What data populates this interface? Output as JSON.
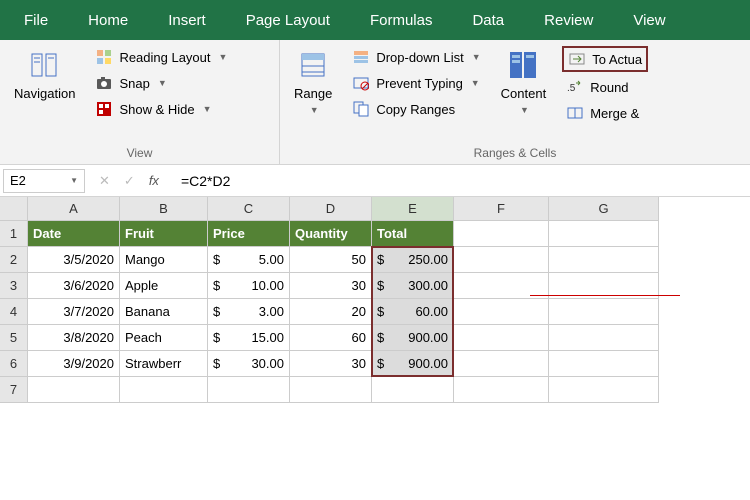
{
  "menu": [
    "File",
    "Home",
    "Insert",
    "Page Layout",
    "Formulas",
    "Data",
    "Review",
    "View"
  ],
  "ribbon": {
    "group1": {
      "nav": "Navigation",
      "reading": "Reading Layout",
      "snap": "Snap",
      "showhide": "Show & Hide",
      "label": "View"
    },
    "group2": {
      "range": "Range",
      "dropdown": "Drop-down List",
      "prevent": "Prevent Typing",
      "copy": "Copy Ranges",
      "content": "Content",
      "toactual": "To Actua",
      "round": "Round",
      "merge": "Merge &",
      "label": "Ranges & Cells"
    }
  },
  "namebox": "E2",
  "formula": "=C2*D2",
  "columns": [
    "A",
    "B",
    "C",
    "D",
    "E",
    "F",
    "G"
  ],
  "rows": [
    "1",
    "2",
    "3",
    "4",
    "5",
    "6",
    "7"
  ],
  "headers": {
    "A": "Date",
    "B": "Fruit",
    "C": "Price",
    "D": "Quantity",
    "E": "Total"
  },
  "data": [
    {
      "A": "3/5/2020",
      "B": "Mango",
      "Ca": "$",
      "Cb": "5.00",
      "D": "50",
      "Ea": "$",
      "Eb": "250.00"
    },
    {
      "A": "3/6/2020",
      "B": "Apple",
      "Ca": "$",
      "Cb": "10.00",
      "D": "30",
      "Ea": "$",
      "Eb": "300.00"
    },
    {
      "A": "3/7/2020",
      "B": "Banana",
      "Ca": "$",
      "Cb": "3.00",
      "D": "20",
      "Ea": "$",
      "Eb": "60.00"
    },
    {
      "A": "3/8/2020",
      "B": "Peach",
      "Ca": "$",
      "Cb": "15.00",
      "D": "60",
      "Ea": "$",
      "Eb": "900.00"
    },
    {
      "A": "3/9/2020",
      "B": "Strawberr",
      "Ca": "$",
      "Cb": "30.00",
      "D": "30",
      "Ea": "$",
      "Eb": "900.00"
    }
  ]
}
